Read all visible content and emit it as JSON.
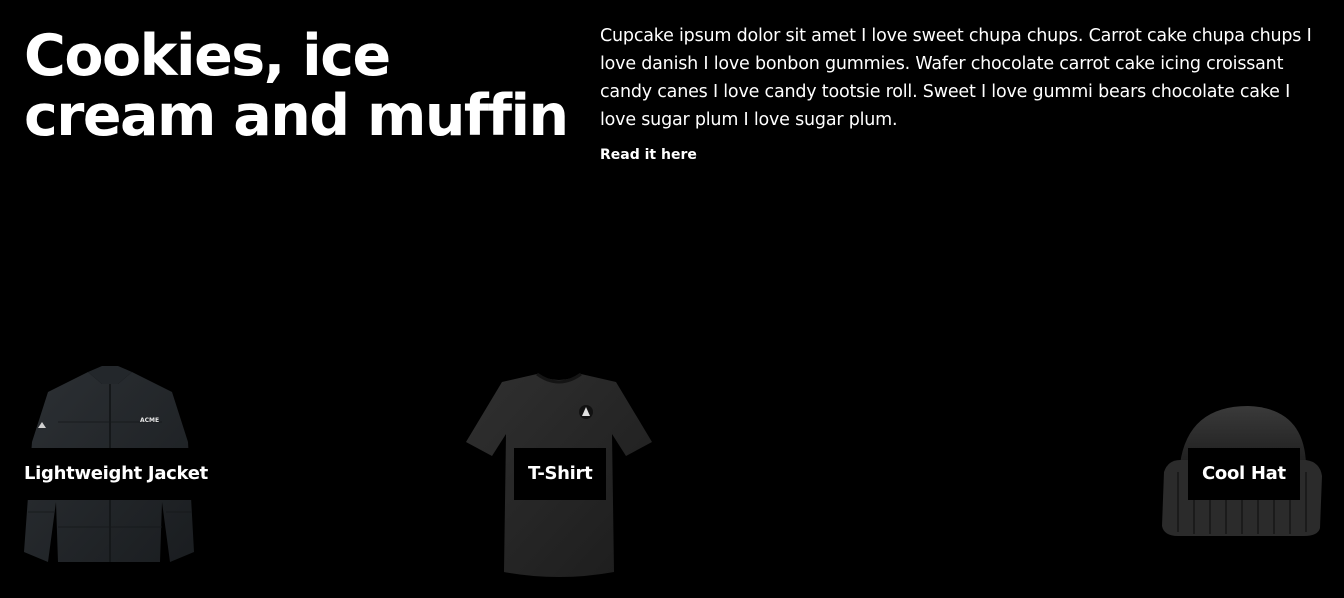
{
  "hero": {
    "title": "Cookies, ice cream and muffin",
    "description": "Cupcake ipsum dolor sit amet I love sweet chupa chups. Carrot cake chupa chups I love danish I love bonbon gummies. Wafer chocolate carrot cake icing croissant candy canes I love candy tootsie roll. Sweet I love gummi bears chocolate cake I love sugar plum I love sugar plum.",
    "link_label": "Read it here"
  },
  "products": [
    {
      "name": "Lightweight Jacket",
      "icon": "jacket-image",
      "brand_text": "ACME"
    },
    {
      "name": "T-Shirt",
      "icon": "tshirt-image"
    },
    {
      "name": "Cool Hat",
      "icon": "beanie-image"
    }
  ],
  "colors": {
    "background": "#000000",
    "text": "#ffffff",
    "garment": "#2a2a2a"
  }
}
